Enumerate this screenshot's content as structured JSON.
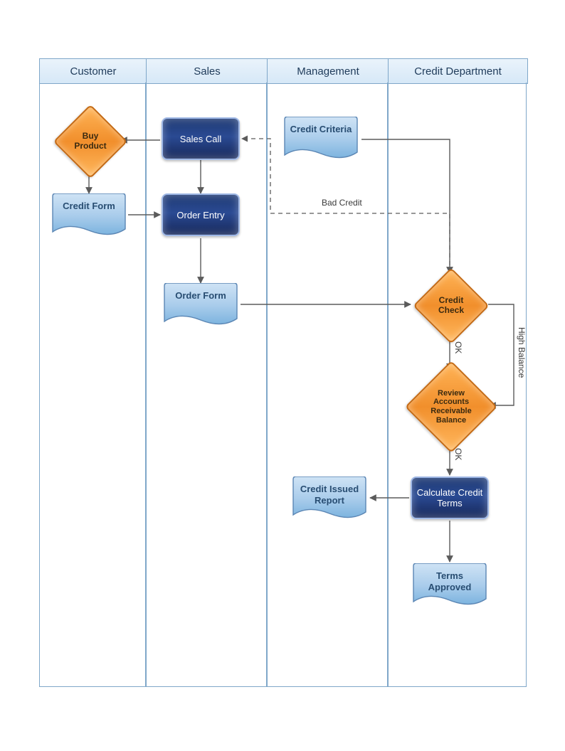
{
  "lanes": {
    "customer": "Customer",
    "sales": "Sales",
    "management": "Management",
    "credit_dept": "Credit Department"
  },
  "nodes": {
    "buy_product": "Buy Product",
    "sales_call": "Sales Call",
    "credit_criteria": "Credit Criteria",
    "credit_form": "Credit Form",
    "order_entry": "Order Entry",
    "order_form": "Order Form",
    "credit_check": "Credit Check",
    "review_ar_balance": "Review Accounts Receivable Balance",
    "credit_issued_report": "Credit Issued Report",
    "calculate_credit_terms": "Calculate Credit Terms",
    "terms_approved": "Terms Approved"
  },
  "edge_labels": {
    "bad_credit": "Bad Credit",
    "ok1": "OK",
    "ok2": "OK",
    "high_balance": "High Balance"
  },
  "colors": {
    "lane_border": "#7fa7c9",
    "process_fill": "#1f3a73",
    "decision_fill": "#f18f2c",
    "doc_fill_top": "#bdd9f0",
    "doc_fill_bottom": "#8fbde4",
    "doc_stroke": "#5b86b4",
    "arrow": "#5b5b5b"
  }
}
